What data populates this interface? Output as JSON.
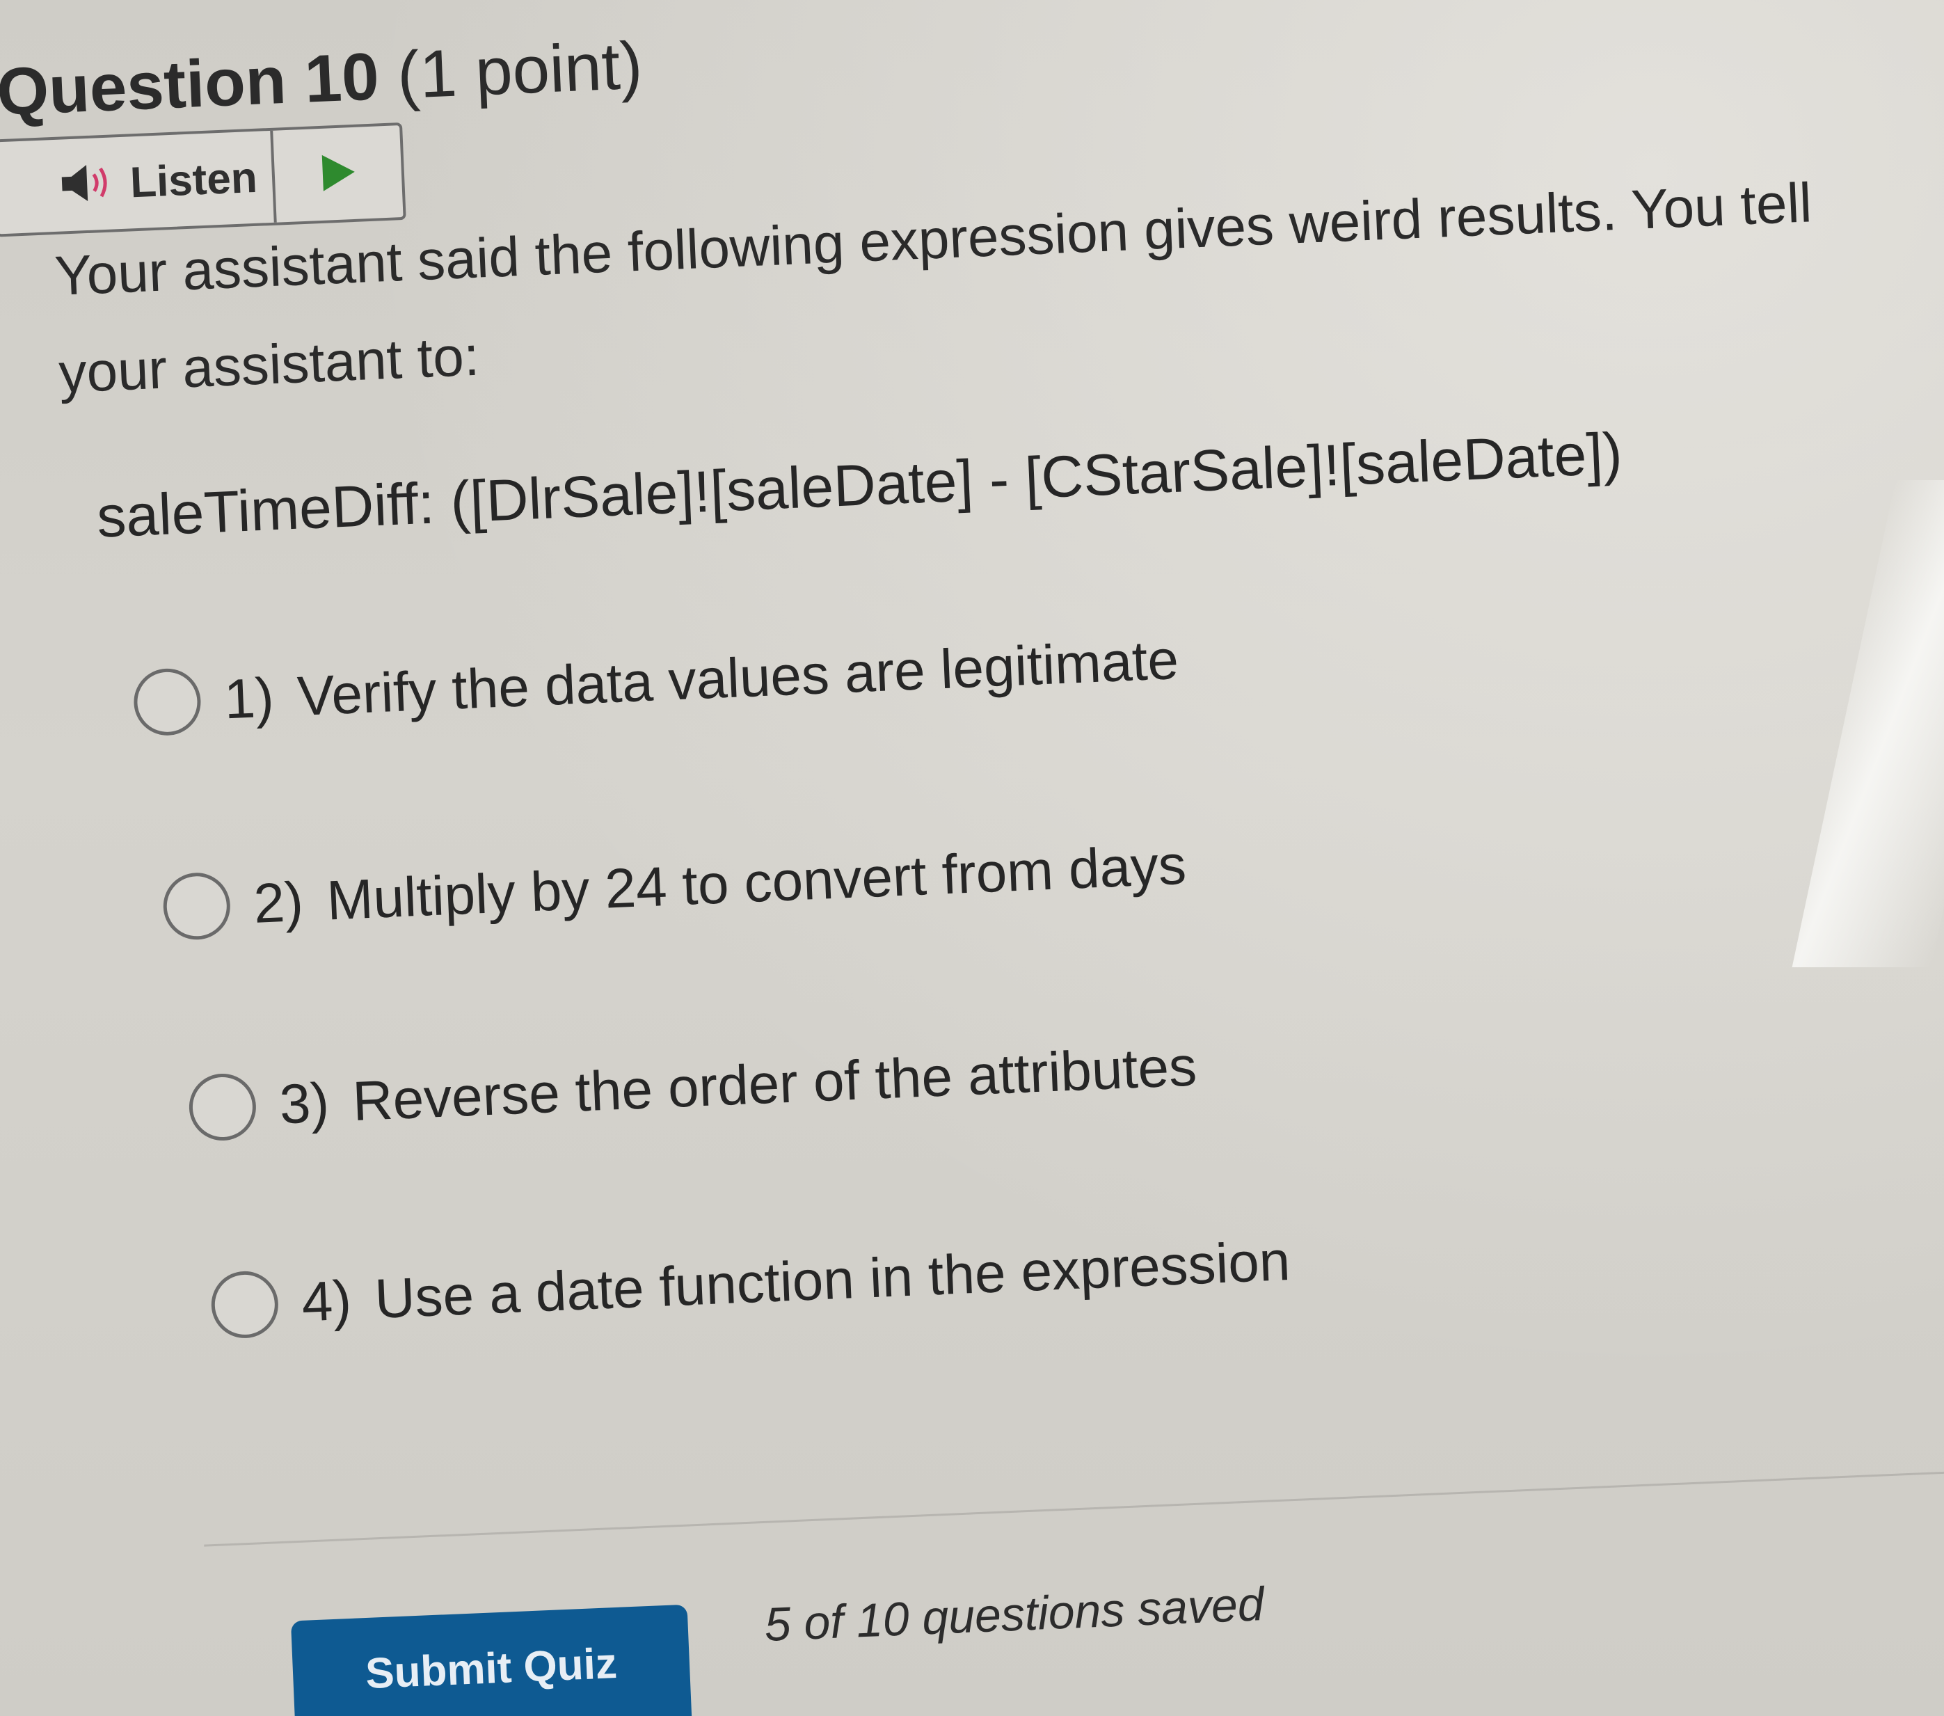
{
  "question": {
    "title": "Question 10",
    "points": "(1 point)"
  },
  "listen": {
    "label": "Listen",
    "speaker_icon": "speaker-icon",
    "play_icon": "play-icon",
    "play_color": "#2e8a2e"
  },
  "prompt": {
    "text": "Your assistant said the following expression gives weird results. You tell your assistant to:"
  },
  "expression": {
    "text": "saleTimeDiff: ([DlrSale]![saleDate] - [CStarSale]![saleDate])"
  },
  "options": [
    {
      "number": "1)",
      "label": "Verify the data values are legitimate",
      "selected": false
    },
    {
      "number": "2)",
      "label": "Multiply by 24 to convert from days",
      "selected": false
    },
    {
      "number": "3)",
      "label": "Reverse the order of the attributes",
      "selected": false
    },
    {
      "number": "4)",
      "label": "Use a date function in the expression",
      "selected": false
    }
  ],
  "footer": {
    "submit_label": "Submit Quiz",
    "saved_status": "5 of 10 questions saved",
    "submit_color": "#0e5a92"
  }
}
